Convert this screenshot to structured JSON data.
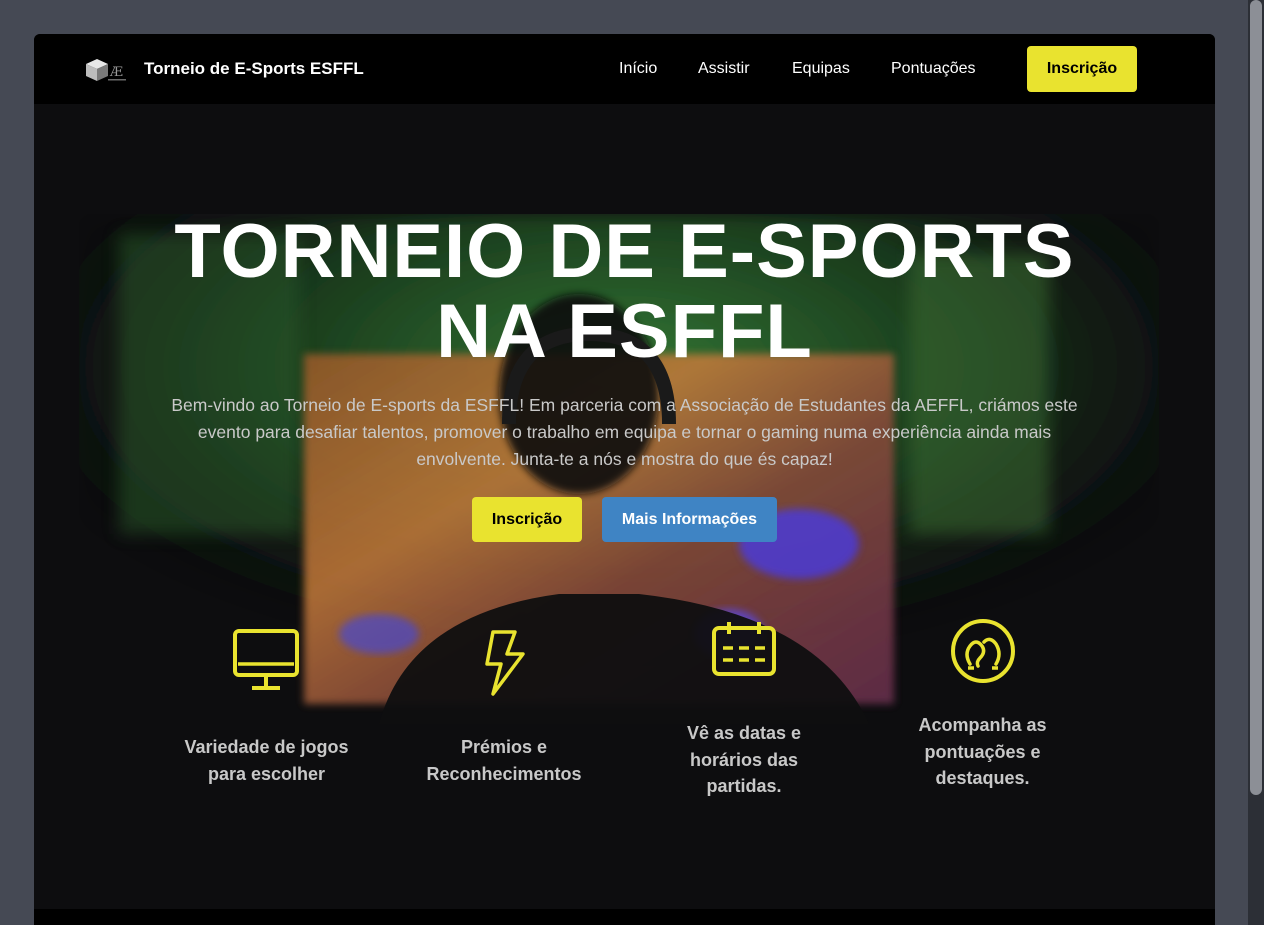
{
  "brand": {
    "title": "Torneio de E-Sports ESFFL",
    "logo_icon": "cube-logo-icon"
  },
  "nav": {
    "items": [
      {
        "label": "Início"
      },
      {
        "label": "Assistir"
      },
      {
        "label": "Equipas"
      },
      {
        "label": "Pontuações"
      }
    ],
    "cta_label": "Inscrição"
  },
  "hero": {
    "title_line1": "TORNEIO DE E-SPORTS",
    "title_line2": "NA ESFFL",
    "text_line1": "Bem-vindo ao Torneio de E-sports da ESFFL! Em parceria com a Associação de Estudantes da AEFFL, criámos este",
    "text_line2": "evento para desafiar talentos, promover o trabalho em equipa e tornar o gaming numa experiência ainda mais",
    "text_line3": "envolvente. Junta-te a nós e mostra do que és capaz!",
    "primary_button": "Inscrição",
    "secondary_button": "Mais Informações"
  },
  "features": [
    {
      "icon": "monitor-icon",
      "line1": "Variedade de jogos",
      "line2": "para escolher",
      "line3": ""
    },
    {
      "icon": "lightning-icon",
      "line1": "Prémios e",
      "line2": "Reconhecimentos",
      "line3": ""
    },
    {
      "icon": "calendar-icon",
      "line1": "Vê as datas e",
      "line2": "horários das",
      "line3": "partidas."
    },
    {
      "icon": "heads-icon",
      "line1": "Acompanha as",
      "line2": "pontuações e",
      "line3": "destaques."
    }
  ],
  "colors": {
    "accent_yellow": "#e9e32f",
    "accent_blue": "#3f84c4",
    "background": "#0d0d0f"
  }
}
